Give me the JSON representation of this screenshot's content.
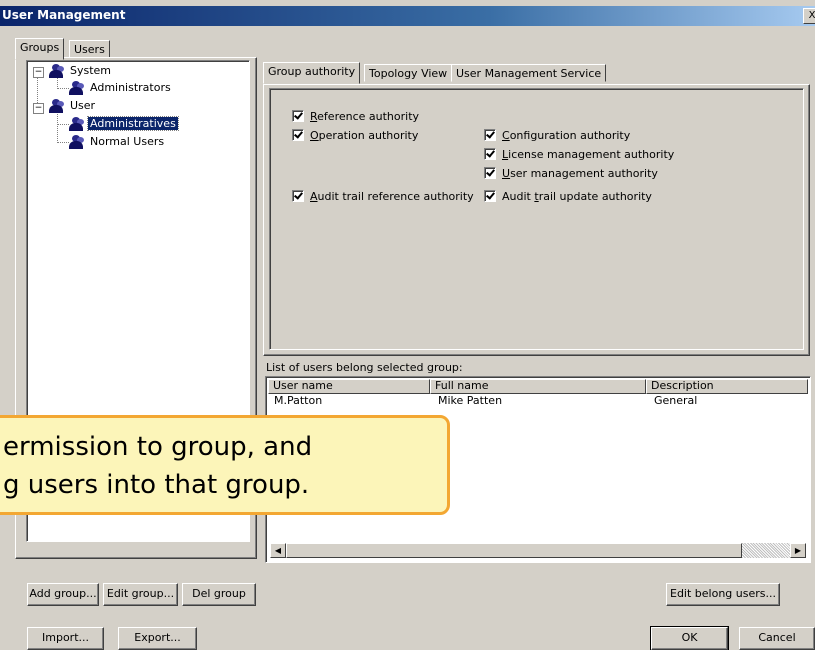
{
  "window": {
    "title": "User Management",
    "close_glyph": "X"
  },
  "left_tabs": [
    {
      "label": "Groups"
    },
    {
      "label": "Users"
    }
  ],
  "tree": {
    "nodes": [
      {
        "label": "System",
        "expander": "−"
      },
      {
        "label": "Administrators"
      },
      {
        "label": "User",
        "expander": "−"
      },
      {
        "label": "Administratives"
      },
      {
        "label": "Normal Users"
      }
    ]
  },
  "right_tabs": [
    {
      "label": "Group authority"
    },
    {
      "label": "Topology View"
    },
    {
      "label": "User Management Service"
    }
  ],
  "authorities": {
    "reference": {
      "u": "R",
      "rest": "eference authority"
    },
    "operation": {
      "u": "O",
      "rest": "peration authority"
    },
    "configuration": {
      "u": "C",
      "rest": "onfiguration authority"
    },
    "license": {
      "u": "L",
      "rest": "icense management authority"
    },
    "user_mgmt": {
      "u": "U",
      "rest": "ser management authority"
    },
    "audit_ref": {
      "u": "A",
      "rest": "udit trail reference authority"
    },
    "audit_update": {
      "pre": "Audit ",
      "u": "t",
      "rest": "rail update authority"
    }
  },
  "user_list": {
    "caption": "List of users belong selected group:",
    "columns": [
      "User name",
      "Full name",
      "Description"
    ],
    "rows": [
      {
        "user_name": "M.Patton",
        "full_name": "Mike Patten",
        "description": "General"
      }
    ]
  },
  "buttons": {
    "add_group": "Add group...",
    "edit_group": "Edit group...",
    "del_group": "Del group",
    "edit_belong_users": "Edit belong users...",
    "import": "Import...",
    "export": "Export...",
    "ok": "OK",
    "cancel": "Cancel"
  },
  "callout": {
    "line1": "ermission to group, and",
    "line2": "g users into that group."
  },
  "colors": {
    "titlebar": "#0a246a",
    "selection": "#0a246a",
    "dialog_face": "#d4d0c8",
    "callout_bg": "#fcf5b9",
    "callout_border": "#f3a732"
  }
}
